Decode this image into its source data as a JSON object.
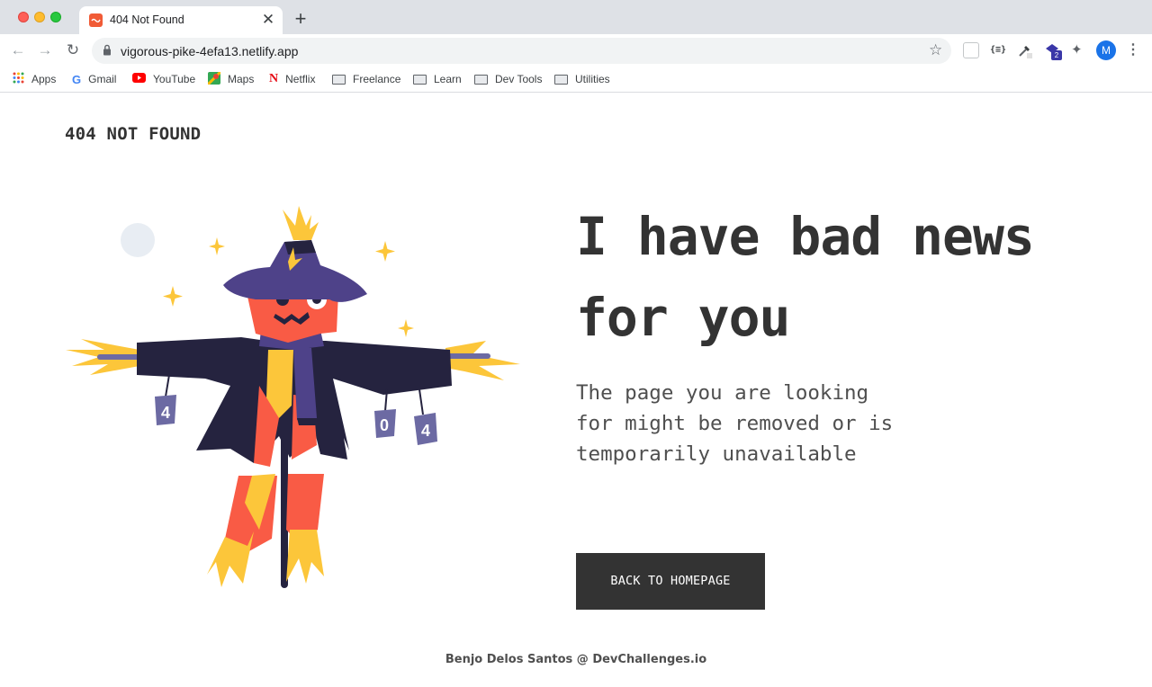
{
  "browser": {
    "tab": {
      "title": "404 Not Found",
      "close_glyph": "✕"
    },
    "new_tab_glyph": "+",
    "nav": {
      "back_glyph": "←",
      "forward_glyph": "→",
      "reload_glyph": "↻"
    },
    "omnibox": {
      "url": "vigorous-pike-4efa13.netlify.app"
    },
    "extension_badge": "2",
    "profile_initial": "M",
    "menu_glyph": "⋮",
    "json_ext_label": "{≡}",
    "bookmarks": [
      {
        "label": "Apps",
        "icon": "apps-grid-icon"
      },
      {
        "label": "Gmail",
        "icon": "google-icon"
      },
      {
        "label": "YouTube",
        "icon": "youtube-icon"
      },
      {
        "label": "Maps",
        "icon": "maps-icon"
      },
      {
        "label": "Netflix",
        "icon": "netflix-icon"
      },
      {
        "label": "Freelance",
        "icon": "folder-icon"
      },
      {
        "label": "Learn",
        "icon": "folder-icon"
      },
      {
        "label": "Dev Tools",
        "icon": "folder-icon"
      },
      {
        "label": "Utilities",
        "icon": "folder-icon"
      }
    ]
  },
  "page": {
    "brand": "404 NOT FOUND",
    "headline": "I have bad news for you",
    "description": "The page you are looking for might be removed or is temporarily unavailable",
    "cta_label": "BACK TO HOMEPAGE",
    "footer": "Benjo Delos Santos @ DevChallenges.io",
    "illustration": {
      "subject": "scarecrow-illustration",
      "can_labels": [
        "4",
        "0",
        "4"
      ]
    }
  },
  "colors": {
    "text_dark": "#333333",
    "text_body": "#4f4f4f",
    "button_bg": "#333333",
    "hat": "#4e4289",
    "coat": "#25233f",
    "head": "#f95b45",
    "straw": "#fcc63a",
    "can": "#6c6aa3"
  }
}
